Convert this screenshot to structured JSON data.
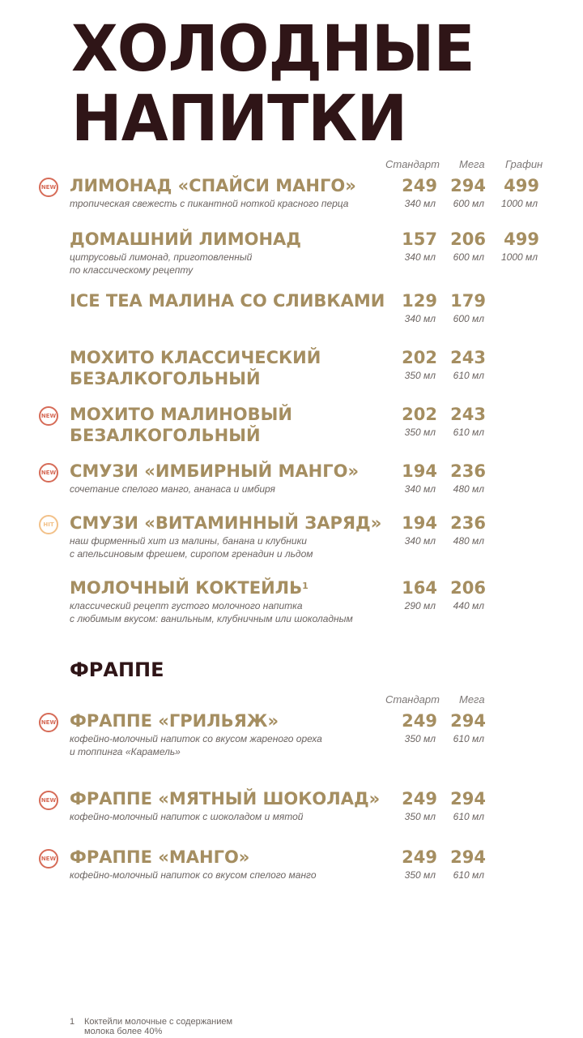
{
  "title": "ХОЛОДНЫЕ\nНАПИТКИ",
  "colors": {
    "title": "#2f1517",
    "gold": "#a58e61",
    "new_badge": "#d66b57",
    "hit_badge": "#f2c189"
  },
  "cold_drinks": {
    "columns": [
      "Стандарт",
      "Мега",
      "Графин"
    ],
    "items": [
      {
        "badge": "NEW",
        "name": "ЛИМОНАД «СПАЙСИ МАНГО»",
        "description": "тропическая свежесть с пикантной ноткой красного перца",
        "prices": [
          {
            "price": "249",
            "volume": "340 мл"
          },
          {
            "price": "294",
            "volume": "600 мл"
          },
          {
            "price": "499",
            "volume": "1000 мл"
          }
        ]
      },
      {
        "badge": "",
        "name": "ДОМАШНИЙ ЛИМОНАД",
        "description": "цитрусовый лимонад, приготовленный\nпо классическому рецепту",
        "prices": [
          {
            "price": "157",
            "volume": "340 мл"
          },
          {
            "price": "206",
            "volume": "600 мл"
          },
          {
            "price": "499",
            "volume": "1000 мл"
          }
        ]
      },
      {
        "badge": "",
        "name": "ICE TEA МАЛИНА СО СЛИВКАМИ",
        "description": "",
        "prices": [
          {
            "price": "129",
            "volume": "340 мл"
          },
          {
            "price": "179",
            "volume": "600 мл"
          }
        ]
      },
      {
        "badge": "",
        "name": "МОХИТО КЛАССИЧЕСКИЙ\nБЕЗАЛКОГОЛЬНЫЙ",
        "description": "",
        "prices": [
          {
            "price": "202",
            "volume": "350 мл"
          },
          {
            "price": "243",
            "volume": "610 мл"
          }
        ]
      },
      {
        "badge": "NEW",
        "name": "МОХИТО МАЛИНОВЫЙ\nБЕЗАЛКОГОЛЬНЫЙ",
        "description": "",
        "prices": [
          {
            "price": "202",
            "volume": "350 мл"
          },
          {
            "price": "243",
            "volume": "610 мл"
          }
        ]
      },
      {
        "badge": "NEW",
        "name": "СМУЗИ «ИМБИРНЫЙ МАНГО»",
        "description": "сочетание спелого манго, ананаса и имбиря",
        "prices": [
          {
            "price": "194",
            "volume": "340 мл"
          },
          {
            "price": "236",
            "volume": "480 мл"
          }
        ]
      },
      {
        "badge": "HIT",
        "name": "СМУЗИ «ВИТАМИННЫЙ ЗАРЯД»",
        "description": "наш фирменный хит из малины, банана и клубники\nс апельсиновым фрешем, сиропом гренадин и льдом",
        "prices": [
          {
            "price": "194",
            "volume": "340 мл"
          },
          {
            "price": "236",
            "volume": "480 мл"
          }
        ]
      },
      {
        "badge": "",
        "name": "МОЛОЧНЫЙ КОКТЕЙЛЬ",
        "footnote_mark": "1",
        "description": "классический рецепт густого молочного напитка\nс любимым вкусом: ванильным, клубничным или шоколадным",
        "prices": [
          {
            "price": "164",
            "volume": "290 мл"
          },
          {
            "price": "206",
            "volume": "440 мл"
          }
        ]
      }
    ]
  },
  "frappe": {
    "title": "ФРАППЕ",
    "columns": [
      "Стандарт",
      "Мега"
    ],
    "items": [
      {
        "badge": "NEW",
        "name": "ФРАППЕ «ГРИЛЬЯЖ»",
        "description": "кофейно-молочный напиток со вкусом жареного ореха\nи топпинга «Карамель»",
        "prices": [
          {
            "price": "249",
            "volume": "350 мл"
          },
          {
            "price": "294",
            "volume": "610 мл"
          }
        ]
      },
      {
        "badge": "NEW",
        "name": "ФРАППЕ «МЯТНЫЙ ШОКОЛАД»",
        "description": "кофейно-молочный напиток с шоколадом и мятой",
        "prices": [
          {
            "price": "249",
            "volume": "350 мл"
          },
          {
            "price": "294",
            "volume": "610 мл"
          }
        ]
      },
      {
        "badge": "NEW",
        "name": "ФРАППЕ «МАНГО»",
        "description": "кофейно-молочный напиток со вкусом спелого манго",
        "prices": [
          {
            "price": "249",
            "volume": "350 мл"
          },
          {
            "price": "294",
            "volume": "610 мл"
          }
        ]
      }
    ]
  },
  "footnote": {
    "number": "1",
    "text": "Коктейли молочные с содержанием\nмолока более 40%"
  }
}
